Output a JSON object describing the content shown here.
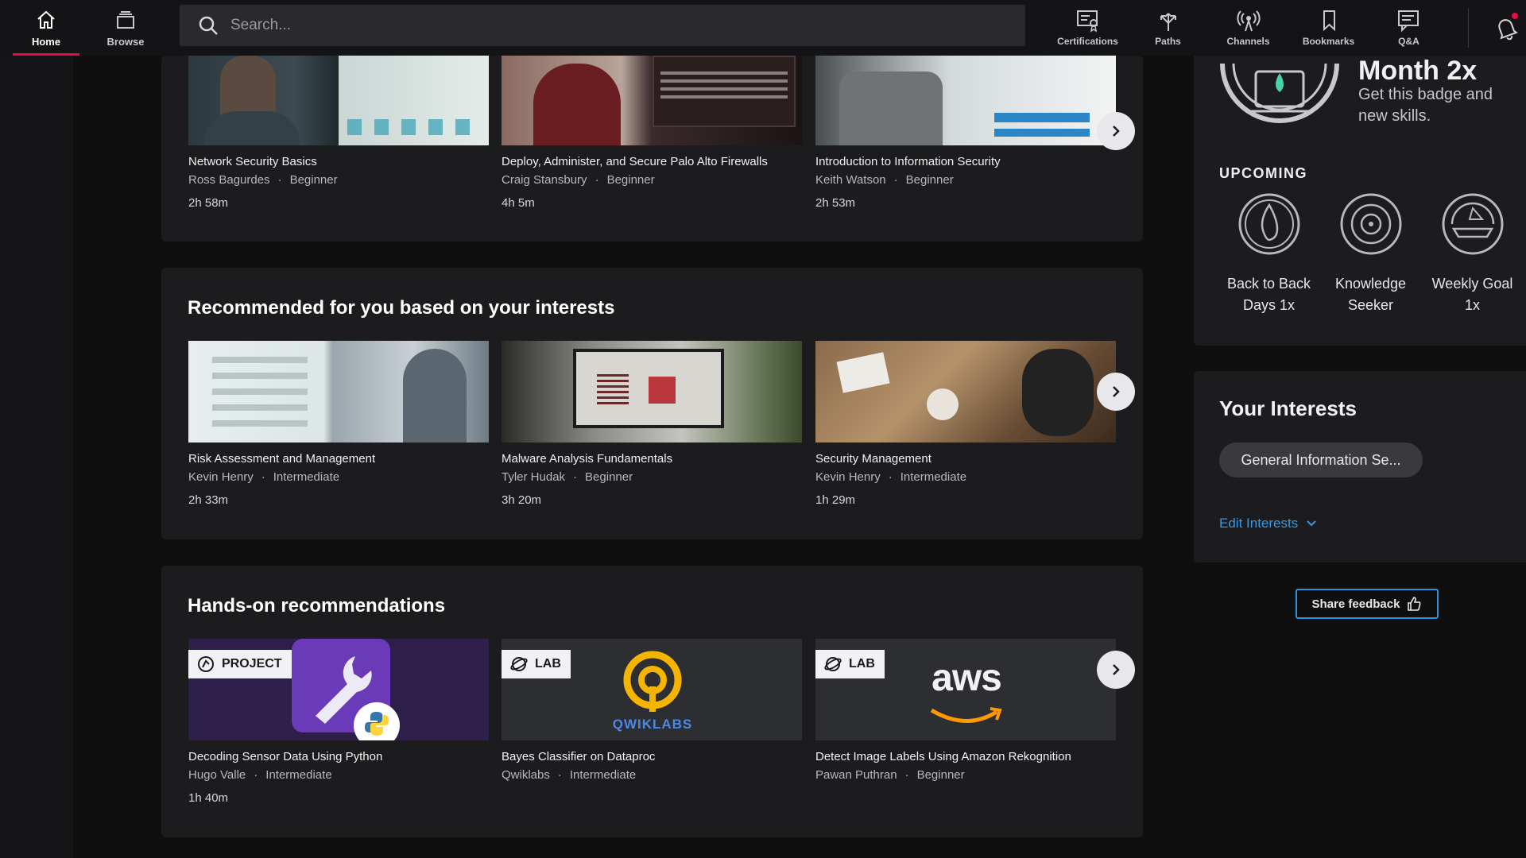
{
  "nav": {
    "home": "Home",
    "browse": "Browse",
    "search_placeholder": "Search...",
    "certifications": "Certifications",
    "paths": "Paths",
    "channels": "Channels",
    "bookmarks": "Bookmarks",
    "qa": "Q&A"
  },
  "row1": {
    "cards": [
      {
        "title": "Network Security Basics",
        "author": "Ross Bagurdes",
        "level": "Beginner",
        "duration": "2h 58m"
      },
      {
        "title": "Deploy, Administer, and Secure Palo Alto Firewalls",
        "author": "Craig Stansbury",
        "level": "Beginner",
        "duration": "4h 5m"
      },
      {
        "title": "Introduction to Information Security",
        "author": "Keith Watson",
        "level": "Beginner",
        "duration": "2h 53m"
      }
    ]
  },
  "recommended": {
    "heading": "Recommended for you based on your interests",
    "cards": [
      {
        "title": "Risk Assessment and Management",
        "author": "Kevin Henry",
        "level": "Intermediate",
        "duration": "2h 33m"
      },
      {
        "title": "Malware Analysis Fundamentals",
        "author": "Tyler Hudak",
        "level": "Beginner",
        "duration": "3h 20m"
      },
      {
        "title": "Security Management",
        "author": "Kevin Henry",
        "level": "Intermediate",
        "duration": "1h 29m"
      }
    ]
  },
  "handson": {
    "heading": "Hands-on recommendations",
    "cards": [
      {
        "tag": "PROJECT",
        "title": "Decoding Sensor Data Using Python",
        "author": "Hugo Valle",
        "level": "Intermediate",
        "duration": "1h 40m"
      },
      {
        "tag": "LAB",
        "title": "Bayes Classifier on Dataproc",
        "author": "Qwiklabs",
        "level": "Intermediate",
        "duration": "",
        "logo": "QWIKLABS"
      },
      {
        "tag": "LAB",
        "title": "Detect Image Labels Using Amazon Rekognition",
        "author": "Pawan Puthran",
        "level": "Beginner",
        "duration": "",
        "logo": "aws"
      }
    ]
  },
  "badge": {
    "title": "Month 2x",
    "subtitle_line1": "Get this badge and",
    "subtitle_line2": "new skills.",
    "upcoming_label": "UPCOMING",
    "upcoming": [
      {
        "line1": "Back to Back",
        "line2": "Days 1x"
      },
      {
        "line1": "Knowledge",
        "line2": "Seeker"
      },
      {
        "line1": "Weekly Goal",
        "line2": "1x"
      }
    ]
  },
  "interests": {
    "heading": "Your Interests",
    "chip": "General Information Se...",
    "edit_label": "Edit Interests"
  },
  "feedback": {
    "label": "Share feedback"
  },
  "colors": {
    "accent": "#ec0b43",
    "link": "#2f8fd8",
    "panel": "#1c1c1e"
  },
  "separator": "·"
}
